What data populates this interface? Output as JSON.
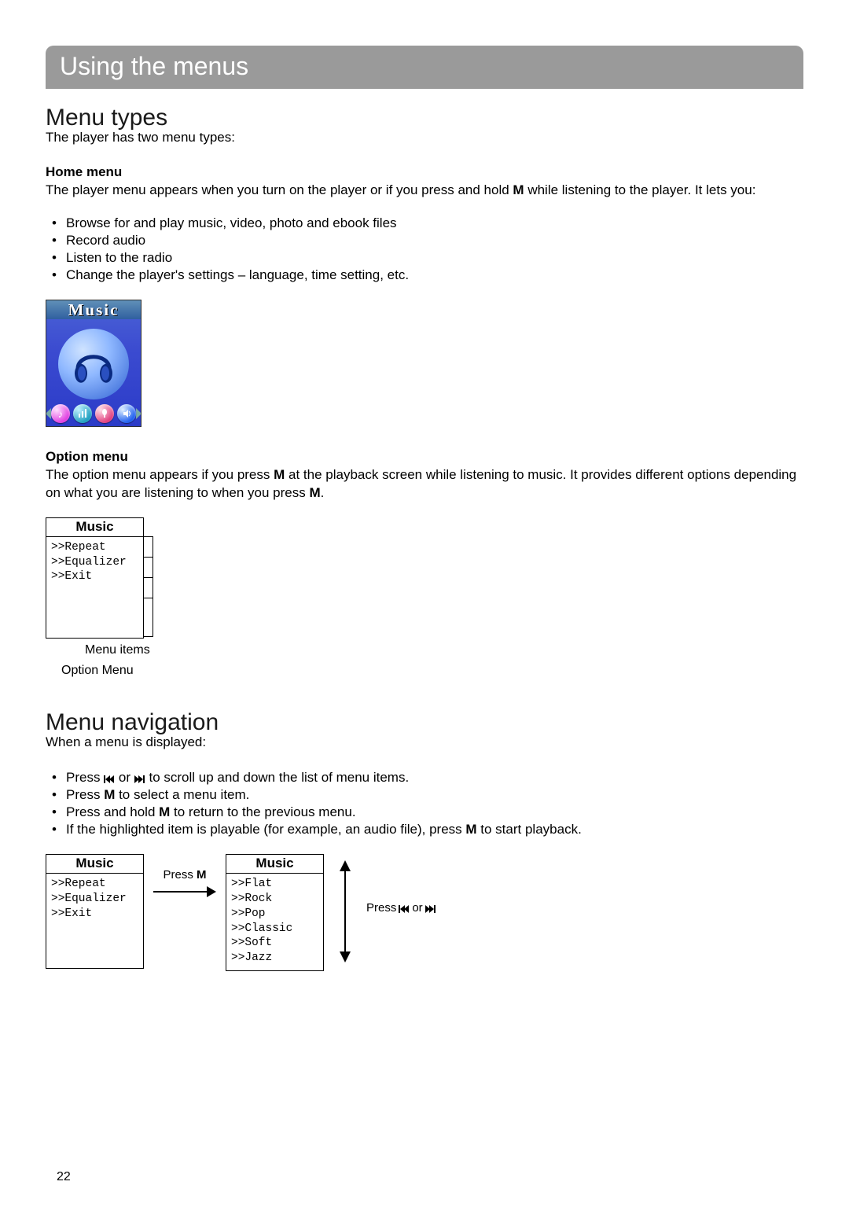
{
  "banner": "Using the menus",
  "section1": {
    "title": "Menu types",
    "intro": "The player has two menu types:",
    "home_label": "Home menu",
    "home_text_pre": "The player menu appears when you turn on the player or if you press and hold ",
    "home_text_bold": "M",
    "home_text_post": " while listening to the player. It lets you:",
    "home_bullets": [
      "Browse for and play music, video, photo and ebook files",
      "Record audio",
      "Listen to the radio",
      "Change the player's settings – language, time setting, etc."
    ],
    "icon_title": "Music",
    "option_label": "Option menu",
    "option_text_pre": "The option menu appears if you press ",
    "option_text_bold1": "M",
    "option_text_mid": " at the playback screen while listening to music. It provides different options depending on what you are listening to when you press ",
    "option_text_bold2": "M",
    "option_text_post": "."
  },
  "option_menu": {
    "title": "Music",
    "items": [
      ">>Repeat",
      ">>Equalizer",
      ">>Exit"
    ],
    "caption_items": "Menu items",
    "caption_menu": "Option Menu"
  },
  "section2": {
    "title": "Menu navigation",
    "intro": "When a menu is displayed:",
    "b1_pre": "Press ",
    "b1_post": " to scroll up and down the list of menu items.",
    "b1_or": " or ",
    "b2_pre": "Press ",
    "b2_bold": "M",
    "b2_post": " to select a menu item.",
    "b3_pre": "Press and hold ",
    "b3_bold": "M",
    "b3_post": " to return to the previous menu.",
    "b4_pre": "If the highlighted item is playable (for example, an audio file), press ",
    "b4_bold": "M",
    "b4_post": " to start playback."
  },
  "nav_diagram": {
    "left": {
      "title": "Music",
      "items": [
        ">>Repeat",
        ">>Equalizer",
        ">>Exit"
      ]
    },
    "press_m": "Press ",
    "press_m_bold": "M",
    "right": {
      "title": "Music",
      "items": [
        ">>Flat",
        ">>Rock",
        ">>Pop",
        ">>Classic",
        ">>Soft",
        ">>Jazz"
      ]
    },
    "press_skip": "Press ",
    "press_skip_or": " or "
  },
  "page_number": "22"
}
